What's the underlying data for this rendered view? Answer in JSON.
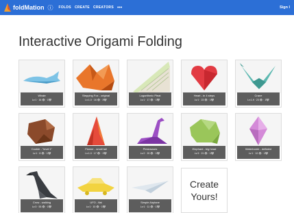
{
  "nav": {
    "brand": "foldMation",
    "links": [
      "FOLDS",
      "CREATE",
      "CREATORS"
    ],
    "more": "•••",
    "signin": "Sign I"
  },
  "page": {
    "title": "Interactive Origami Folding"
  },
  "cards": [
    {
      "name": "Whale",
      "stats": "Lv:1 · 16 👁 · 1❤"
    },
    {
      "name": "Stepping Fox - original",
      "stats": "Lv:1.0 · 16 👁 · 3❤"
    },
    {
      "name": "Logarithmic Pleat",
      "stats": "Lv:1 · 17 👁 · 1❤"
    },
    {
      "name": "Heart - in 4 steps",
      "stats": "Lv:1 · 23 👁 · 1❤"
    },
    {
      "name": "Crane",
      "stats": "Lv:1.9 · 23 👁 · 1❤"
    },
    {
      "name": "Cookie - \"level 1\"",
      "stats": "Lv:1 · 8 👁 · 1❤"
    },
    {
      "name": "Flamer - small tail",
      "stats": "Lv:1.0 · 17 👁 · 1❤"
    },
    {
      "name": "Plesiosaurs",
      "stats": "Lv:2 · 20 👁 · 1❤"
    },
    {
      "name": "Elephant - big head",
      "stats": "Lv:3 · 21 👁 · 1❤"
    },
    {
      "name": "Waterbomb - deflated",
      "stats": "Lv:1 · 12 👁 · 1❤"
    },
    {
      "name": "Crow - walking",
      "stats": "Lv:3 · 53 👁 · 1❤"
    },
    {
      "name": "UFO - flat",
      "stats": "Lv:1 · 10 👁 · 1❤"
    },
    {
      "name": "Simple Airplane",
      "stats": "Lv:1 · 11 👁 · 1❤"
    }
  ],
  "create": {
    "label": "Create\nYours!"
  },
  "colors": {
    "nav": "#2c6fd6",
    "caption": "#5d5d5d"
  }
}
